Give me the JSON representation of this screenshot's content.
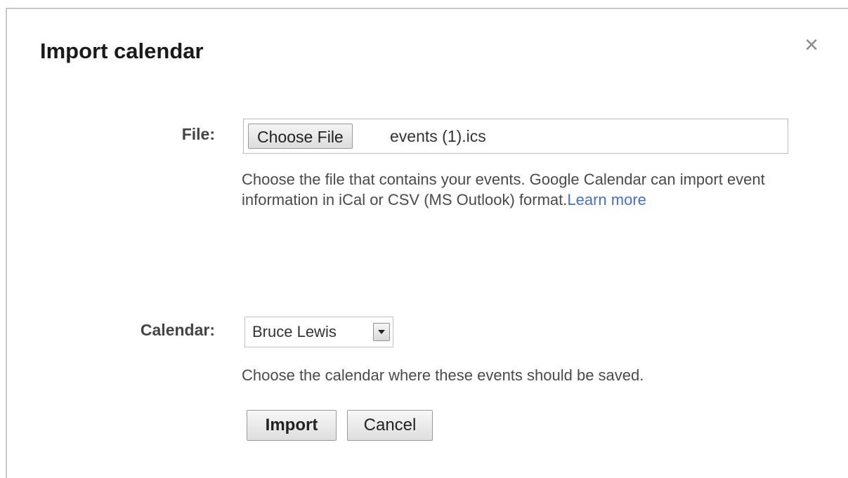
{
  "dialog": {
    "title": "Import calendar",
    "close_symbol": "×"
  },
  "file": {
    "label": "File:",
    "button_label": "Choose File",
    "selected_file": "events (1).ics",
    "help_text": "Choose the file that contains your events. Google Calendar can import event information in iCal or CSV (MS Outlook) format.",
    "learn_more_label": "Learn more"
  },
  "calendar": {
    "label": "Calendar:",
    "selected": "Bruce Lewis",
    "help_text": "Choose the calendar where these events should be saved."
  },
  "actions": {
    "import_label": "Import",
    "cancel_label": "Cancel"
  },
  "colors": {
    "link": "#4a6fbf",
    "close_icon": "#8a8a8a"
  },
  "icons": {
    "close": "close-icon",
    "dropdown": "chevron-down-icon"
  }
}
